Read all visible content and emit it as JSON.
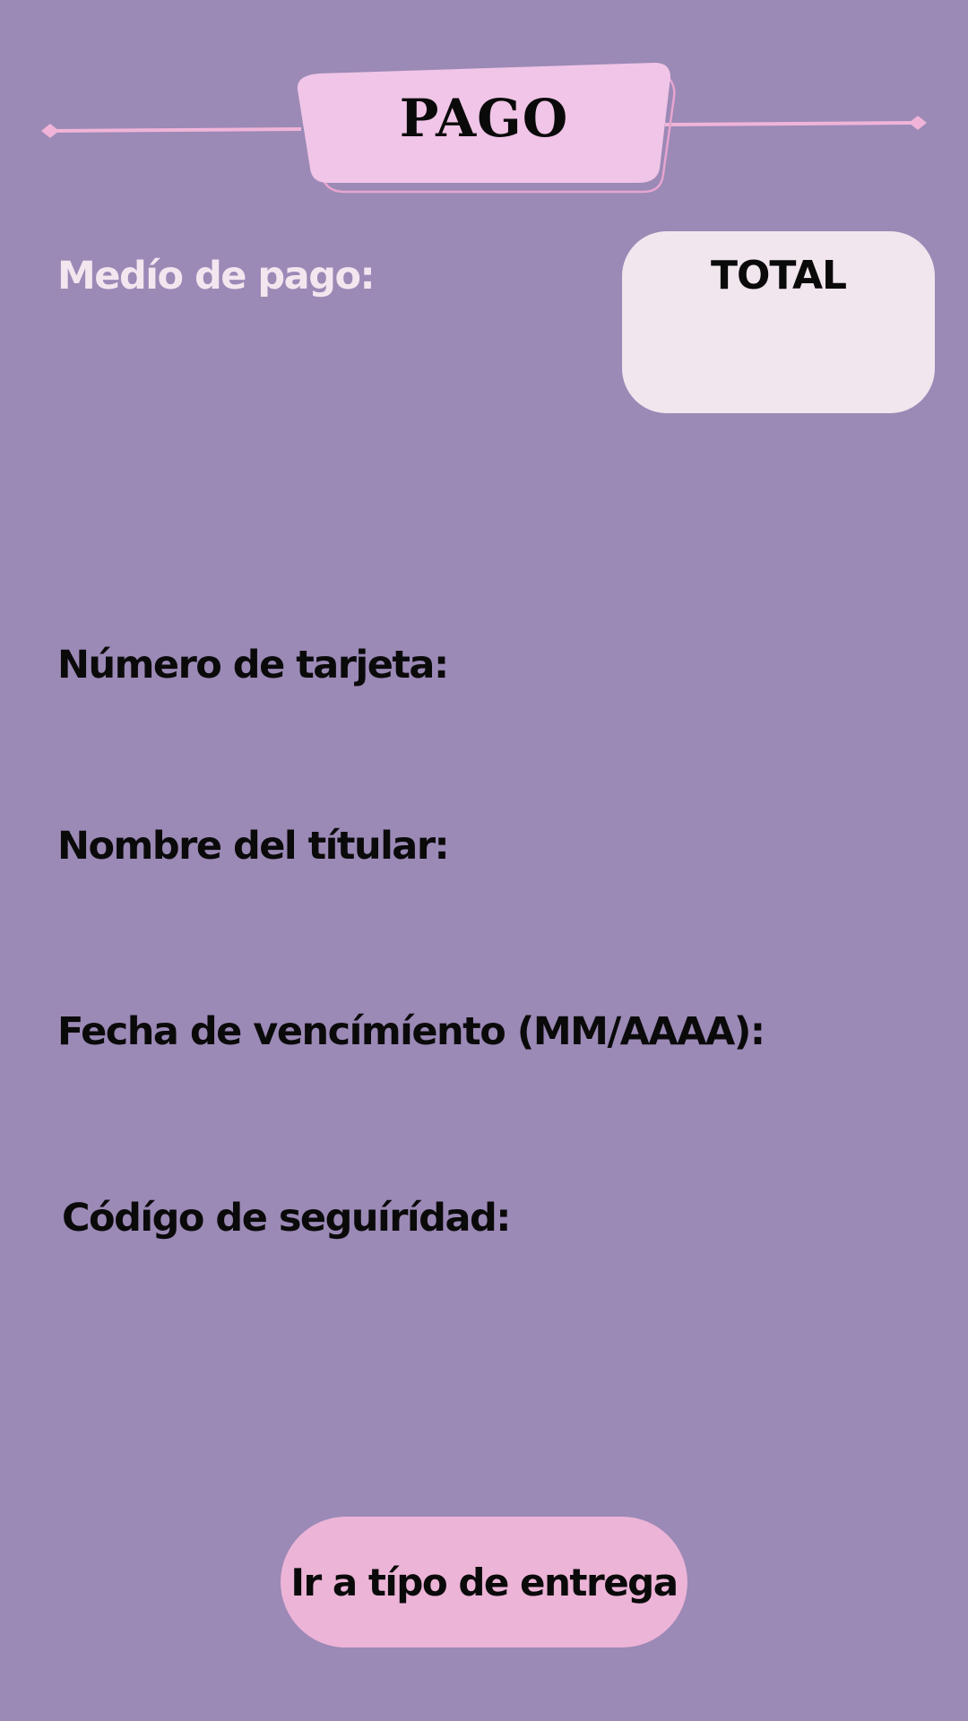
{
  "header": {
    "title": "PAGO"
  },
  "colors": {
    "background": "#9b89b6",
    "banner": "#f0c5e7",
    "accent_line": "#f0b4d8",
    "total_box": "#f1e6ee",
    "button": "#ecb4d7"
  },
  "payment": {
    "method_label": "Medío de pago:"
  },
  "total": {
    "label": "TOTAL",
    "value": ""
  },
  "form": {
    "card_number_label": "Número de tarjeta:",
    "card_number_value": "",
    "holder_label": "Nombre del títular:",
    "holder_value": "",
    "expiry_label": "Fecha de vencímíento (MM/AAAA):",
    "expiry_value": "",
    "cvv_label": "Códígo de seguírídad:",
    "cvv_value": ""
  },
  "actions": {
    "next_label": "Ir a típo de entrega"
  }
}
